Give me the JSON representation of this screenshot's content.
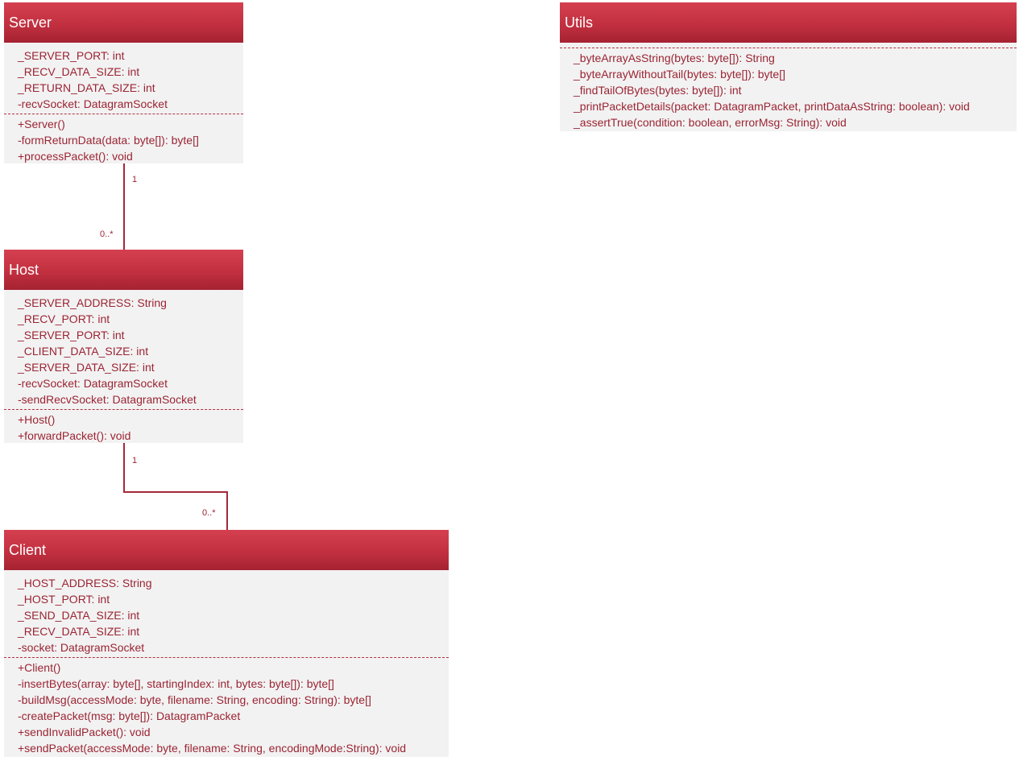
{
  "classes": {
    "server": {
      "name": "Server",
      "attributes": [
        "_SERVER_PORT: int",
        "_RECV_DATA_SIZE: int",
        "_RETURN_DATA_SIZE: int",
        "-recvSocket: DatagramSocket"
      ],
      "methods": [
        "+Server()",
        "-formReturnData(data: byte[]): byte[]",
        "+processPacket(): void"
      ]
    },
    "utils": {
      "name": "Utils",
      "attributes": [],
      "methods": [
        "_byteArrayAsString(bytes: byte[]): String",
        "_byteArrayWithoutTail(bytes: byte[]): byte[]",
        "_findTailOfBytes(bytes: byte[]): int",
        "_printPacketDetails(packet: DatagramPacket, printDataAsString: boolean): void",
        "_assertTrue(condition: boolean, errorMsg: String): void"
      ]
    },
    "host": {
      "name": "Host",
      "attributes": [
        "_SERVER_ADDRESS: String",
        "_RECV_PORT: int",
        "_SERVER_PORT: int",
        "_CLIENT_DATA_SIZE: int",
        "_SERVER_DATA_SIZE: int",
        "-recvSocket: DatagramSocket",
        "-sendRecvSocket: DatagramSocket"
      ],
      "methods": [
        "+Host()",
        "+forwardPacket(): void"
      ]
    },
    "client": {
      "name": "Client",
      "attributes": [
        "_HOST_ADDRESS: String",
        "_HOST_PORT: int",
        "_SEND_DATA_SIZE: int",
        "_RECV_DATA_SIZE: int",
        "-socket: DatagramSocket"
      ],
      "methods": [
        "+Client()",
        "-insertBytes(array: byte[], startingIndex: int, bytes: byte[]): byte[]",
        "-buildMsg(accessMode: byte, filename: String, encoding:  String): byte[]",
        "-createPacket(msg: byte[]): DatagramPacket",
        "+sendInvalidPacket(): void",
        "+sendPacket(accessMode: byte, filename: String, encodingMode:String): void"
      ]
    }
  },
  "associations": {
    "server_host": {
      "source_multiplicity": "1",
      "target_multiplicity": "0..*"
    },
    "host_client": {
      "source_multiplicity": "1",
      "target_multiplicity": "0..*"
    }
  },
  "colors": {
    "header_top": "#d44050",
    "header_bottom": "#a52232",
    "body_background": "#f2f2f2",
    "text": "#9b2433",
    "line": "#a42a38"
  }
}
